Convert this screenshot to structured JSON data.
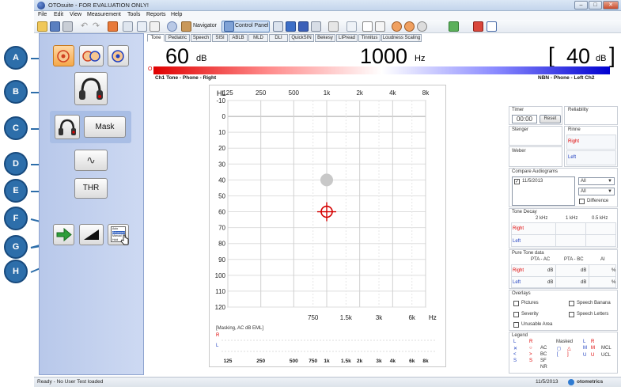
{
  "window": {
    "title": "OTOsuite - FOR EVALUATION ONLY!",
    "buttons": [
      "–",
      "□",
      "✕"
    ]
  },
  "menu": [
    "File",
    "Edit",
    "View",
    "Measurement",
    "Tools",
    "Reports",
    "Help"
  ],
  "toolbar": {
    "navigator_label": "Navigator",
    "control_panel_label": "Control Panel"
  },
  "callouts": [
    "A",
    "B",
    "C",
    "D",
    "E",
    "F",
    "G",
    "H"
  ],
  "controls": {
    "mask_label": "Mask",
    "thr_label": "THR",
    "tone_symbol": "∿",
    "popup_items": [
      "Auto",
      "Advanced",
      "Manual",
      "Hold"
    ]
  },
  "tabs": [
    "Tone",
    "Pediatric",
    "Speech",
    "SISI",
    "ABLB",
    "MLD",
    "DLI",
    "QuickSIN",
    "Bekesy",
    "LIPread",
    "Tinnitus",
    "Loudness Scaling"
  ],
  "readout": {
    "left_value": "60",
    "left_unit": "dB",
    "freq_value": "1000",
    "freq_unit": "Hz",
    "right_value": "40",
    "right_unit": "dB",
    "bracket_open": "[",
    "bracket_close": "]",
    "left_marker": "O"
  },
  "channels": {
    "ch1": "Ch1 Tone - Phone - Right",
    "ch2": "NBN - Phone - Left Ch2"
  },
  "audiogram": {
    "y_label": "HL",
    "x_unit": "Hz",
    "top_freqs": [
      "125",
      "250",
      "500",
      "1k",
      "2k",
      "4k",
      "8k"
    ],
    "bottom_freqs": [
      "750",
      "1.5k",
      "3k",
      "6k"
    ],
    "y_ticks": [
      "-10",
      "0",
      "10",
      "20",
      "30",
      "40",
      "50",
      "60",
      "70",
      "80",
      "90",
      "100",
      "110",
      "120"
    ],
    "cursor_freq_hz": 1000,
    "cursor_level_db": 60,
    "marker_level_db": 40,
    "cursor_color": "#d40000",
    "marker_color": "#c8c8c8"
  },
  "masking": {
    "title": "[Masking, AC dB EML]",
    "r_label": "R",
    "l_label": "L",
    "freqs": [
      "125",
      "250",
      "500",
      "750",
      "1k",
      "1.5k",
      "2k",
      "3k",
      "4k",
      "6k",
      "8k"
    ]
  },
  "timer": {
    "title": "Timer",
    "value": "00:00",
    "reset_label": "Reset"
  },
  "reliability": {
    "title": "Reliability"
  },
  "stenger": {
    "title": "Stenger"
  },
  "rinne": {
    "title": "Rinne",
    "right": "Right",
    "left": "Left"
  },
  "weber": {
    "title": "Weber"
  },
  "compare": {
    "title": "Compare Audiograms",
    "item_date": "11/5/2013",
    "select1": "All",
    "select2": "All",
    "difference_label": "Difference"
  },
  "tone_decay": {
    "title": "Tone Decay",
    "cols": [
      "2 kHz",
      "1 kHz",
      "0.5 kHz"
    ],
    "right": "Right",
    "left": "Left"
  },
  "pure_tone": {
    "title": "Pure Tone data",
    "cols": [
      "PTA - AC",
      "PTA - BC",
      "AI"
    ],
    "right": "Right",
    "left": "Left",
    "unit_db": "dB",
    "unit_pct": "%"
  },
  "overlays": {
    "title": "Overlays",
    "items": [
      "Pictures",
      "Speech Banana",
      "Severity",
      "Speech Letters",
      "Unusable Area"
    ]
  },
  "legend": {
    "title": "Legend",
    "masked_label": "Masked",
    "rows": [
      [
        "✕",
        "○",
        "AC",
        "◻",
        "△"
      ],
      [
        "<",
        ">",
        "BC",
        "[",
        "]"
      ],
      [
        "S",
        "S",
        "SF",
        "",
        ""
      ],
      [
        "",
        "",
        "NR",
        "",
        ""
      ]
    ],
    "lr_top": [
      "L",
      "R",
      "L",
      "R"
    ],
    "mcl": "MCL",
    "ucl": "UCL",
    "mcl_sym": "M",
    "ucl_sym": "U"
  },
  "status": {
    "left": "Ready - No User Test loaded",
    "date": "11/5/2013",
    "brand": "otometrics"
  }
}
